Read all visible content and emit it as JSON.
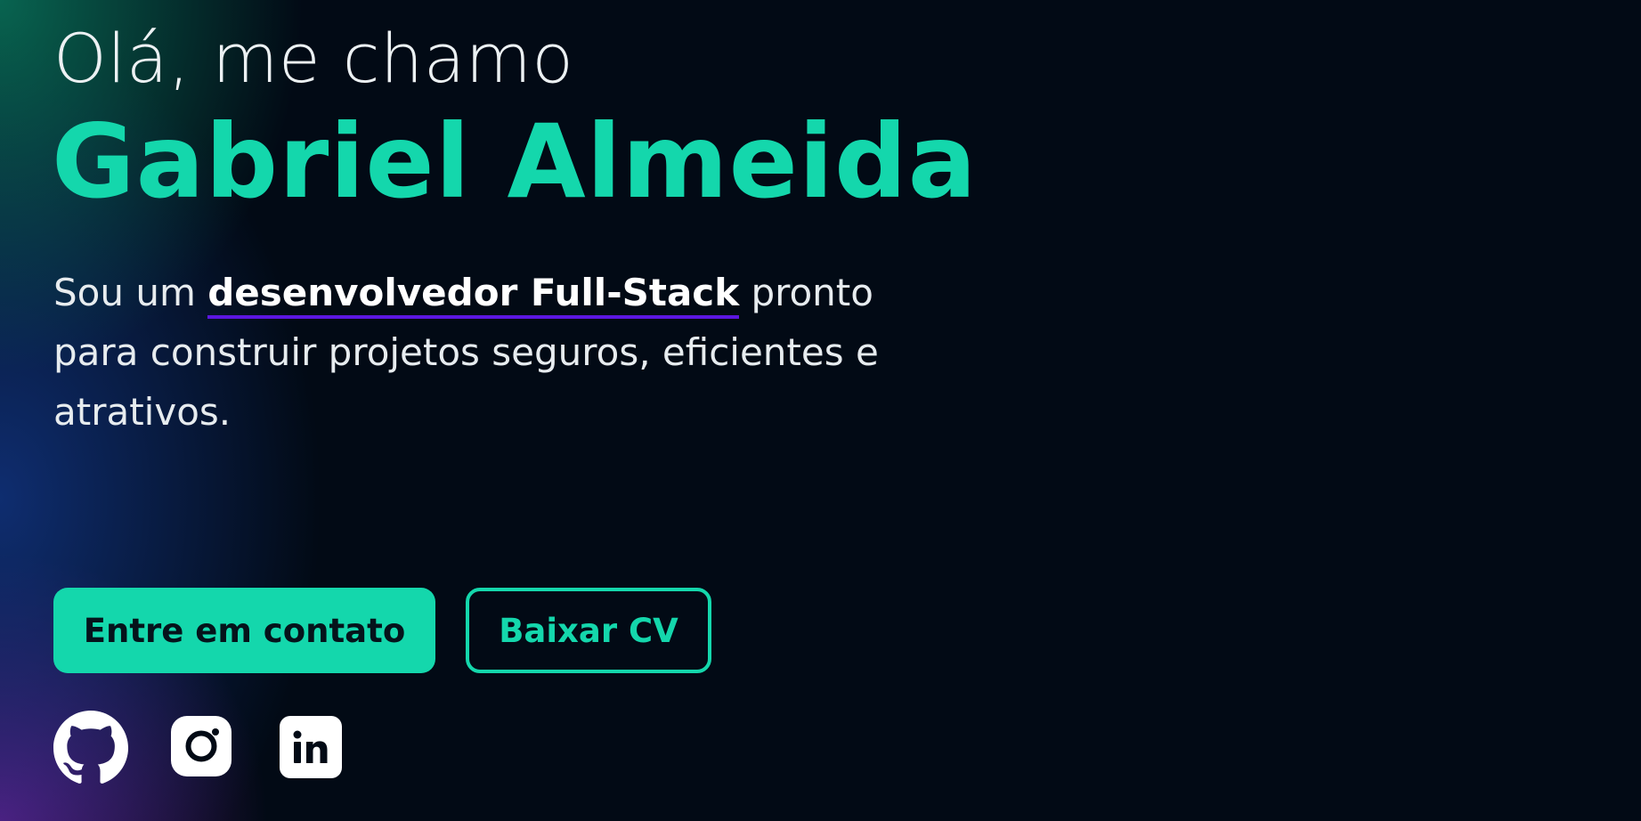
{
  "hero": {
    "greeting": "Olá, me chamo",
    "name": "Gabriel Almeida",
    "intro_before": "Sou um ",
    "intro_highlight": "desenvolvedor Full-Stack",
    "intro_after": " pronto para construir projetos seguros, eficientes e atrativos."
  },
  "actions": {
    "contact_label": "Entre em contato",
    "cv_label": "Baixar CV"
  },
  "social": [
    {
      "icon": "github-icon"
    },
    {
      "icon": "instagram-icon"
    },
    {
      "icon": "linkedin-icon"
    }
  ],
  "colors": {
    "accent": "#14d7ac",
    "background": "#020a15",
    "underline": "#5b16e0",
    "text": "#e7ecef"
  }
}
